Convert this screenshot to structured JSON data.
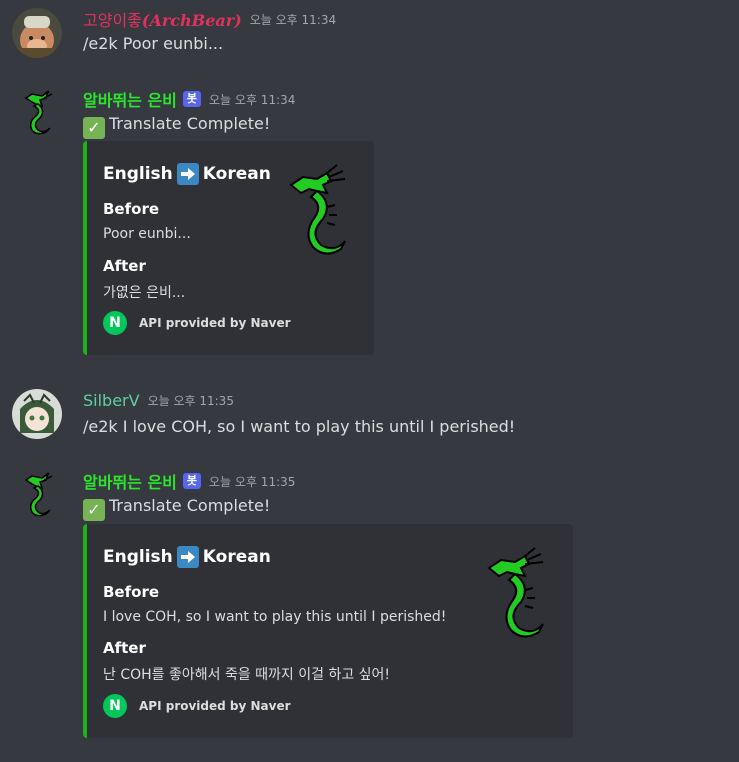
{
  "messages": [
    {
      "username_prefix": "고양이좋",
      "username_fancy": "(ArchBear)",
      "timestamp": "오늘 오후 11:34",
      "text": "/e2k Poor eunbi..."
    },
    {
      "username": "알바뛰는 은비",
      "bot_tag": "봇",
      "timestamp": "오늘 오후 11:34",
      "status_text": "Translate Complete!",
      "embed": {
        "title_from": "English",
        "title_to": "Korean",
        "before_label": "Before",
        "before_value": "Poor eunbi...",
        "after_label": "After",
        "after_value": "가엾은 은비...",
        "footer_icon": "N",
        "footer_text": "API provided by Naver"
      }
    },
    {
      "username": "SilberV",
      "timestamp": "오늘 오후 11:35",
      "text": "/e2k I love COH, so I want to play this until I perished!"
    },
    {
      "username": "알바뛰는 은비",
      "bot_tag": "봇",
      "timestamp": "오늘 오후 11:35",
      "status_text": "Translate Complete!",
      "embed": {
        "title_from": "English",
        "title_to": "Korean",
        "before_label": "Before",
        "before_value": "I love COH, so I want to play this until I perished!",
        "after_label": "After",
        "after_value": "난 COH를 좋아해서 죽을 때까지 이걸 하고 싶어!",
        "footer_icon": "N",
        "footer_text": "API provided by Naver"
      }
    }
  ],
  "colors": {
    "background": "#36393f",
    "embed_background": "#2f3136",
    "embed_border": "#1db21d",
    "bot_name": "#2ee52e",
    "archbear_name": "#e0325e",
    "silber_name": "#5ecfa0",
    "bot_tag": "#5865f2",
    "naver_green": "#03c75a"
  },
  "icons": {
    "check": "check-mark-icon",
    "arrow": "right-arrow-icon",
    "naver": "naver-logo-icon",
    "dragon": "green-dragon-icon"
  }
}
